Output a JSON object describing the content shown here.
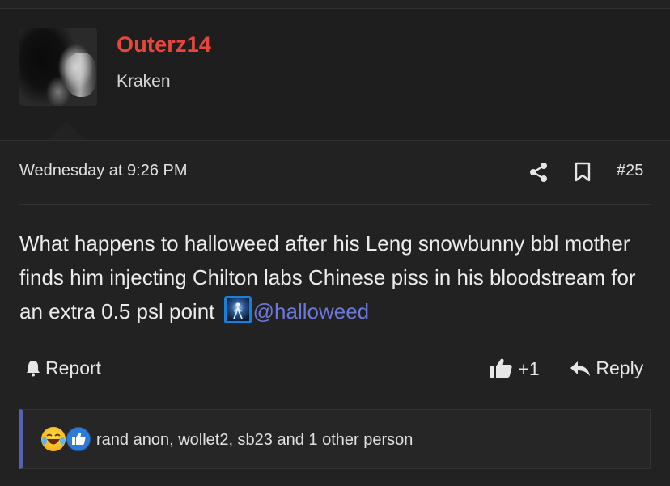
{
  "author": {
    "username": "Outerz14",
    "title": "Kraken"
  },
  "post": {
    "date": "Wednesday at 9:26 PM",
    "number": "#25",
    "text": "What happens to halloweed after his Leng snowbunny bbl mother finds him injecting Chilton labs Chinese piss in his bloodstream for an extra 0.5 psl point",
    "mention": "@halloweed"
  },
  "actions": {
    "report_label": "Report",
    "like_label": "+1",
    "reply_label": "Reply"
  },
  "reactions": {
    "names": "rand anon, wollet2, sb23 and 1 other person",
    "icons": [
      "laughing-crying-emoji",
      "thumbs-up-emoji"
    ]
  },
  "colors": {
    "username": "#e8453c",
    "mention": "#6b78d8",
    "reaction_bar": "#5561b5"
  }
}
